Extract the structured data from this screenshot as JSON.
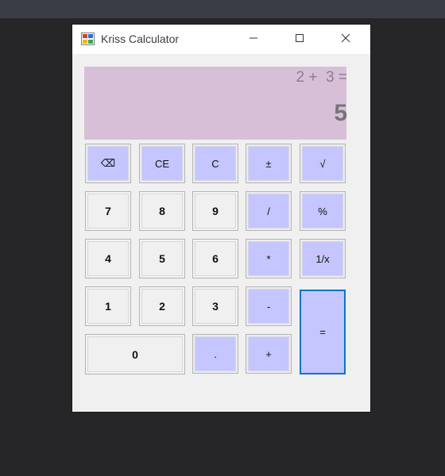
{
  "window": {
    "title": "Kriss Calculator"
  },
  "display": {
    "expression": "2 +  3 =",
    "result": "5"
  },
  "buttons": {
    "backspace": "⌫",
    "ce": "CE",
    "c": "C",
    "negate": "±",
    "sqrt": "√",
    "seven": "7",
    "eight": "8",
    "nine": "9",
    "divide": "/",
    "percent": "%",
    "four": "4",
    "five": "5",
    "six": "6",
    "multiply": "*",
    "reciprocal": "1/x",
    "one": "1",
    "two": "2",
    "three": "3",
    "subtract": "-",
    "zero": "0",
    "decimal": ".",
    "add": "+",
    "equals": "="
  },
  "colors": {
    "display_bg": "#d8bfd8",
    "operator_bg": "#c5c5ff",
    "equals_border": "#0a74c9"
  },
  "icons": {
    "app": "calculator-app-icon",
    "minimize": "minimize-icon",
    "maximize": "maximize-icon",
    "close": "close-icon"
  }
}
